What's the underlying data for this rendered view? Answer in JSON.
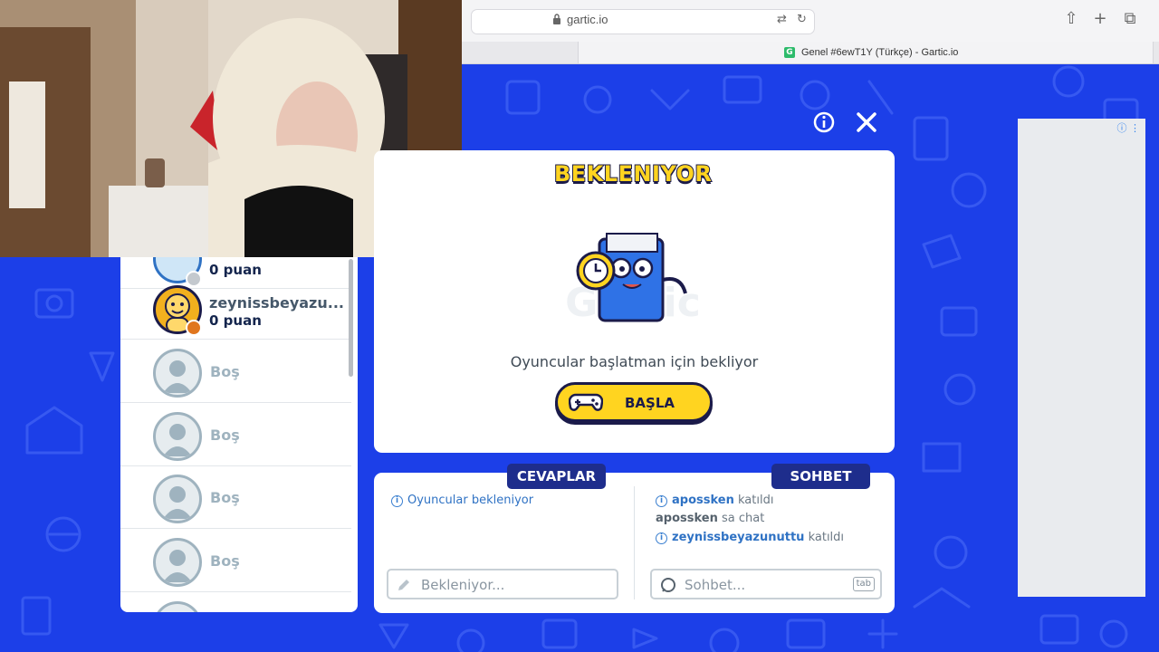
{
  "browser": {
    "url": "gartic.io",
    "tab_title": "Genel #6ewT1Y (Türkçe) - Gartic.io",
    "tab_favicon_letter": "G"
  },
  "colors": {
    "background": "#1c3fe8",
    "accent_yellow": "#ffd420",
    "dark_navy": "#1b1b4a",
    "badge_blue": "#1e2d8c"
  },
  "players": [
    {
      "name": "",
      "score": "0 puan",
      "status": "gray"
    },
    {
      "name": "zeynissbeyazu...",
      "score": "0 puan",
      "status": "orange"
    },
    {
      "empty": "Boş"
    },
    {
      "empty": "Boş"
    },
    {
      "empty": "Boş"
    },
    {
      "empty": "Boş"
    }
  ],
  "main": {
    "title": "BEKLENIYOR",
    "waiting_text": "Oyuncular başlatman için bekliyor",
    "start_label": "BAŞLA"
  },
  "answers": {
    "header": "CEVAPLAR",
    "status": "Oyuncular bekleniyor",
    "placeholder": "Bekleniyor..."
  },
  "chat": {
    "header": "SOHBET",
    "messages": [
      {
        "user": "apossken",
        "text": "katıldı"
      },
      {
        "user": "apossken",
        "text": "sa chat"
      },
      {
        "user": "zeynissbeyazunuttu",
        "text": "katıldı"
      }
    ],
    "placeholder": "Sohbet...",
    "tab_hint": "tab"
  }
}
